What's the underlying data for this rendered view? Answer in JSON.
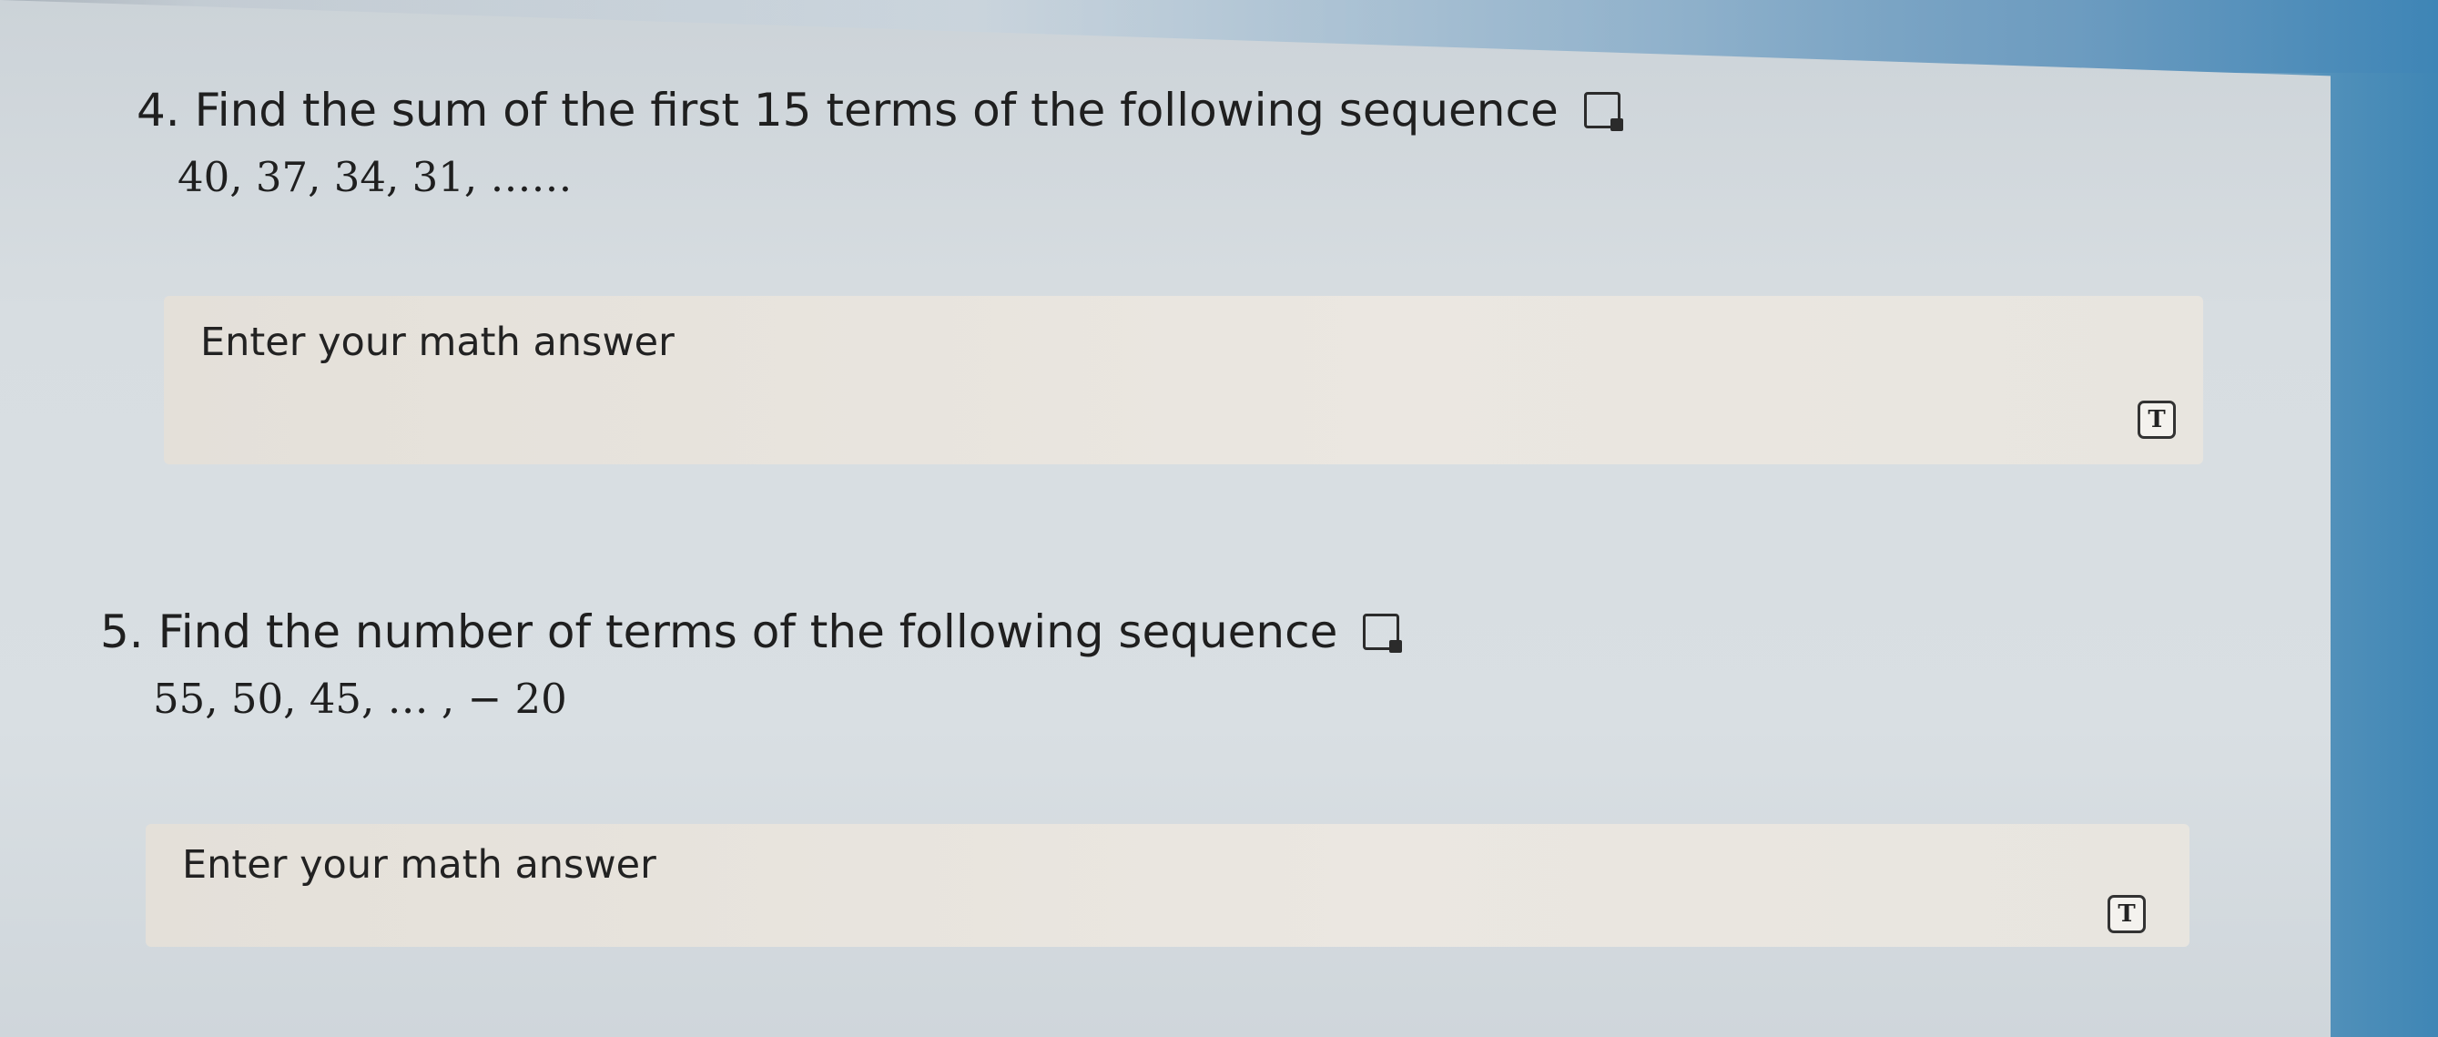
{
  "questions": [
    {
      "number_title": "4. Find the sum of the first 15 terms of the following sequence",
      "sequence": "40, 37, 34, 31, ……",
      "answer_placeholder": "Enter your math answer",
      "text_mode_button": "T"
    },
    {
      "number_title": "5. Find the number of terms of the following sequence",
      "sequence": "55, 50, 45, … , − 20",
      "answer_placeholder": "Enter your math answer",
      "text_mode_button": "T"
    }
  ],
  "icons": {
    "read_aloud": "immersive-reader-icon",
    "text_mode": "text-mode-icon"
  }
}
